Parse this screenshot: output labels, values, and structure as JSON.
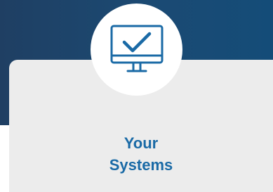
{
  "card": {
    "title_line1": "Your",
    "title_line2": "Systems",
    "icon": "monitor-check-icon"
  },
  "colors": {
    "banner": "#1b4a73",
    "card_background": "#ececec",
    "accent": "#1a6aa6",
    "icon_circle": "#ffffff"
  }
}
